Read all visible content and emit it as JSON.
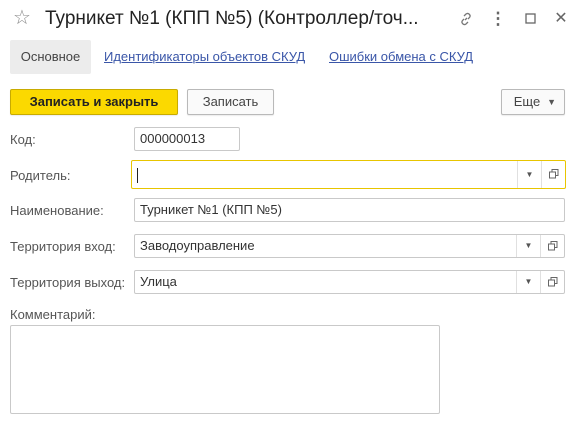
{
  "window": {
    "title": "Турникет №1 (КПП №5) (Контроллер/точ...",
    "star_icon": "star-icon",
    "link_icon": "link-icon",
    "more_icon": "more-vertical-icon",
    "maximize_icon": "maximize-icon",
    "close_icon": "close-icon"
  },
  "tabs": [
    {
      "label": "Основное"
    },
    {
      "label": "Идентификаторы объектов СКУД"
    },
    {
      "label": "Ошибки обмена с СКУД"
    }
  ],
  "toolbar": {
    "save_close_label": "Записать и закрыть",
    "save_label": "Записать",
    "more_label": "Еще"
  },
  "form": {
    "code_label": "Код:",
    "code_value": "000000013",
    "parent_label": "Родитель:",
    "parent_value": "",
    "name_label": "Наименование:",
    "name_value": "Турникет №1 (КПП №5)",
    "territory_in_label": "Территория вход:",
    "territory_in_value": "Заводоуправление",
    "territory_out_label": "Территория выход:",
    "territory_out_value": "Улица",
    "comment_label": "Комментарий:",
    "comment_value": ""
  },
  "colors": {
    "accent": "#fbd900",
    "focus_border": "#e8c500",
    "link": "#3a56a8"
  }
}
